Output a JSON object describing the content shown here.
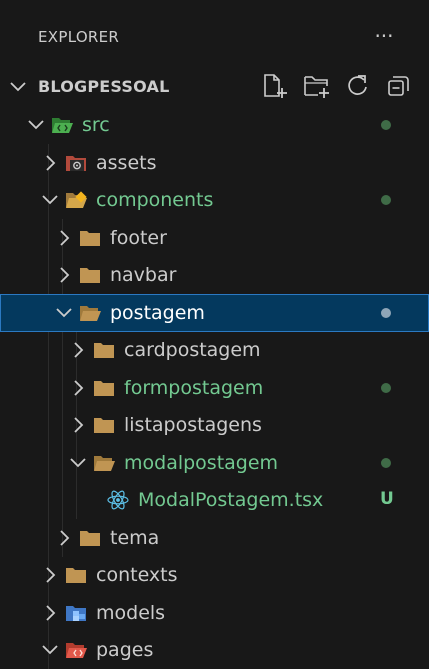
{
  "header": {
    "title": "EXPLORER",
    "more_label": "···"
  },
  "section": {
    "title": "BLOGPESSOAL",
    "actions": [
      {
        "name": "new-file-icon"
      },
      {
        "name": "new-folder-icon"
      },
      {
        "name": "refresh-icon"
      },
      {
        "name": "collapse-all-icon"
      }
    ]
  },
  "colors": {
    "background": "#181818",
    "text": "#cccccc",
    "modified": "#73c991",
    "dot_green": "#3f6b47",
    "dot_selected": "#8fa6b8",
    "selection": "#04395e",
    "selection_border": "#2b79c2",
    "folder": "#c09553"
  },
  "tree": [
    {
      "label": "src",
      "depth": 1,
      "expanded": true,
      "icon": "folder-src-open-icon",
      "status": "modified",
      "dot": true
    },
    {
      "label": "assets",
      "depth": 2,
      "expanded": false,
      "icon": "folder-assets-icon"
    },
    {
      "label": "components",
      "depth": 2,
      "expanded": true,
      "icon": "folder-components-open-icon",
      "status": "modified",
      "dot": true
    },
    {
      "label": "footer",
      "depth": 3,
      "expanded": false,
      "icon": "folder-icon"
    },
    {
      "label": "navbar",
      "depth": 3,
      "expanded": false,
      "icon": "folder-icon"
    },
    {
      "label": "postagem",
      "depth": 3,
      "expanded": true,
      "icon": "folder-open-icon",
      "selected": true,
      "dot": true
    },
    {
      "label": "cardpostagem",
      "depth": 4,
      "expanded": false,
      "icon": "folder-icon"
    },
    {
      "label": "formpostagem",
      "depth": 4,
      "expanded": false,
      "icon": "folder-icon",
      "status": "modified",
      "dot": true
    },
    {
      "label": "listapostagens",
      "depth": 4,
      "expanded": false,
      "icon": "folder-icon"
    },
    {
      "label": "modalpostagem",
      "depth": 4,
      "expanded": true,
      "icon": "folder-open-icon",
      "status": "modified",
      "dot": true
    },
    {
      "label": "ModalPostagem.tsx",
      "depth": 5,
      "file": true,
      "icon": "react-icon",
      "status": "untracked",
      "badge": "U"
    },
    {
      "label": "tema",
      "depth": 3,
      "expanded": false,
      "icon": "folder-icon"
    },
    {
      "label": "contexts",
      "depth": 2,
      "expanded": false,
      "icon": "folder-icon"
    },
    {
      "label": "models",
      "depth": 2,
      "expanded": false,
      "icon": "folder-models-icon"
    },
    {
      "label": "pages",
      "depth": 2,
      "expanded": true,
      "icon": "folder-pages-open-icon"
    }
  ]
}
